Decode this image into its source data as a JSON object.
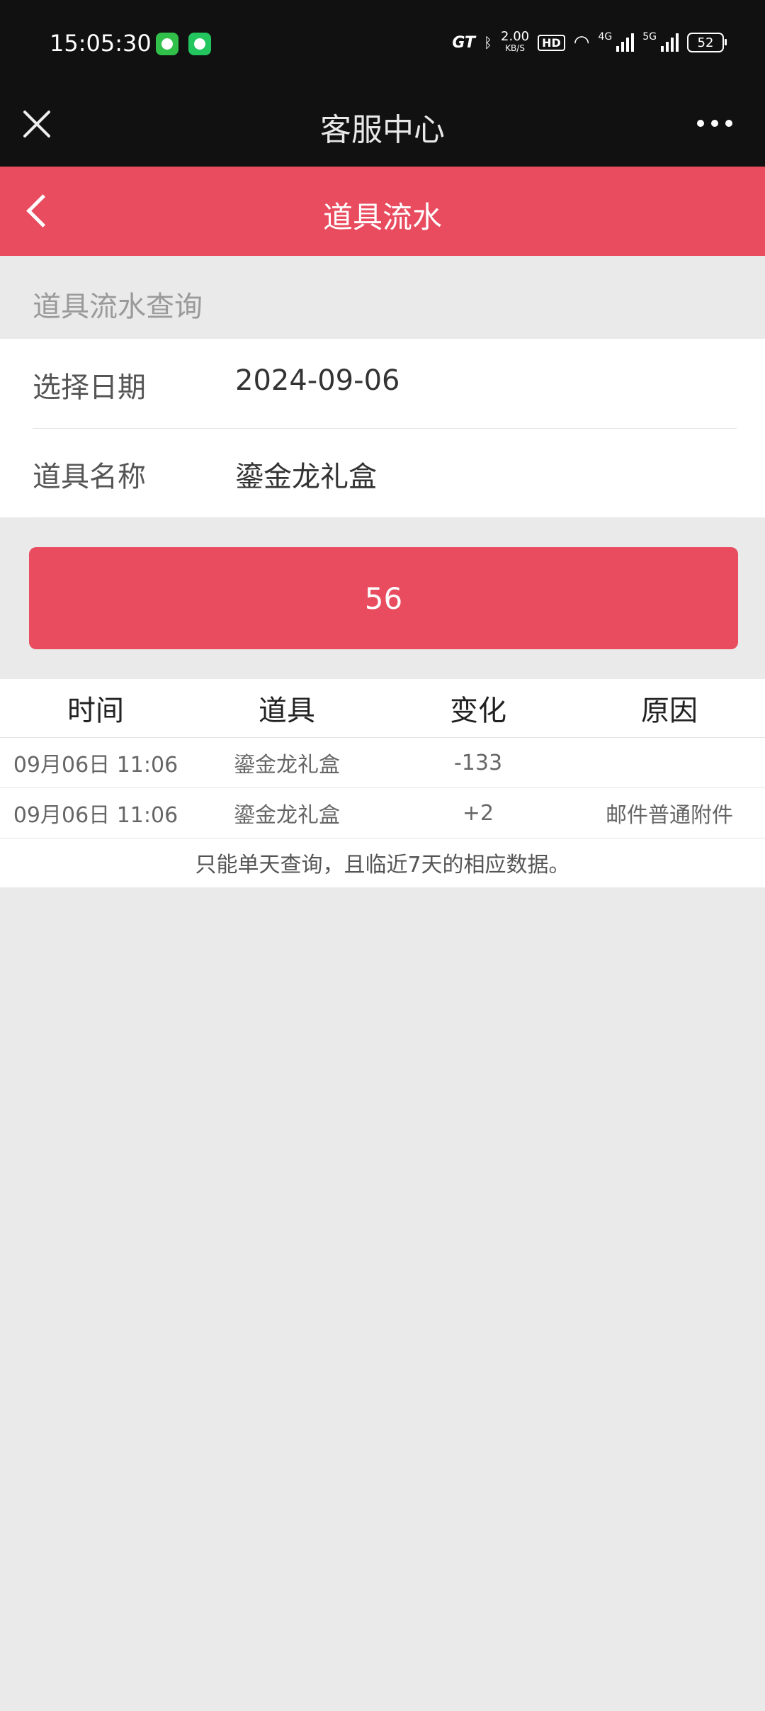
{
  "status_bar": {
    "time": "15:05:30",
    "app_icons": [
      "video-app-icon",
      "chat-app-icon"
    ],
    "gt": "GT",
    "speed_value": "2.00",
    "speed_unit": "KB/S",
    "hd": "HD",
    "net1": "4G",
    "net2": "5G",
    "battery": "52"
  },
  "wechat_bar": {
    "title": "客服中心"
  },
  "header": {
    "title": "道具流水",
    "color": "#e84c5e"
  },
  "section": {
    "label": "道具流水查询"
  },
  "form": {
    "date_label": "选择日期",
    "date_value": "2024-09-06",
    "item_label": "道具名称",
    "item_value": "鎏金龙礼盒"
  },
  "query_button": {
    "label": "56"
  },
  "table": {
    "headers": [
      "时间",
      "道具",
      "变化",
      "原因"
    ],
    "rows": [
      [
        "09月06日 11:06",
        "鎏金龙礼盒",
        "-133",
        ""
      ],
      [
        "09月06日 11:06",
        "鎏金龙礼盒",
        "+2",
        "邮件普通附件"
      ]
    ],
    "note": "只能单天查询，且临近7天的相应数据。"
  }
}
